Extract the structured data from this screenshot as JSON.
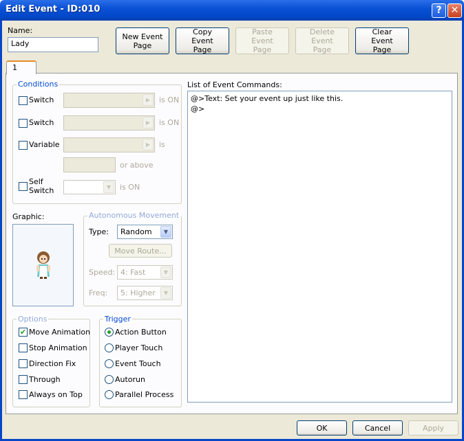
{
  "window": {
    "title": "Edit Event - ID:010",
    "help_icon": "?",
    "close_icon": "✕"
  },
  "name": {
    "label": "Name:",
    "value": "Lady"
  },
  "page_buttons": [
    {
      "label": "New Event Page",
      "enabled": true
    },
    {
      "label": "Copy Event Page",
      "enabled": true
    },
    {
      "label": "Paste Event Page",
      "enabled": false
    },
    {
      "label": "Delete Event Page",
      "enabled": false
    },
    {
      "label": "Clear Event Page",
      "enabled": true
    }
  ],
  "tabs": [
    {
      "label": "1"
    }
  ],
  "conditions": {
    "title": "Conditions",
    "switch1": "Switch",
    "switch2": "Switch",
    "variable": "Variable",
    "self_switch_1": "Self",
    "self_switch_2": "Switch",
    "is_on": "is ON",
    "is": "is",
    "or_above": "or above",
    "self_is_on": "is ON"
  },
  "event_commands": {
    "label": "List of Event Commands:",
    "lines": [
      "@>Text: Set your event up just like this.",
      "@>"
    ]
  },
  "graphic": {
    "label": "Graphic:"
  },
  "movement": {
    "title": "Autonomous Movement",
    "type_label": "Type:",
    "type_value": "Random",
    "move_route": "Move Route...",
    "speed_label": "Speed:",
    "speed_value": "4: Fast",
    "freq_label": "Freq:",
    "freq_value": "5: Higher"
  },
  "options": {
    "title": "Options",
    "items": [
      {
        "label": "Move Animation",
        "checked": true
      },
      {
        "label": "Stop Animation",
        "checked": false
      },
      {
        "label": "Direction Fix",
        "checked": false
      },
      {
        "label": "Through",
        "checked": false
      },
      {
        "label": "Always on Top",
        "checked": false
      }
    ]
  },
  "trigger": {
    "title": "Trigger",
    "items": [
      {
        "label": "Action Button",
        "selected": true
      },
      {
        "label": "Player Touch",
        "selected": false
      },
      {
        "label": "Event Touch",
        "selected": false
      },
      {
        "label": "Autorun",
        "selected": false
      },
      {
        "label": "Parallel Process",
        "selected": false
      }
    ]
  },
  "footer": {
    "ok": "OK",
    "cancel": "Cancel",
    "apply": "Apply"
  },
  "colors": {
    "title_bar": "#0a52d6",
    "group_title": "#0046d5",
    "check": "#21a121"
  }
}
